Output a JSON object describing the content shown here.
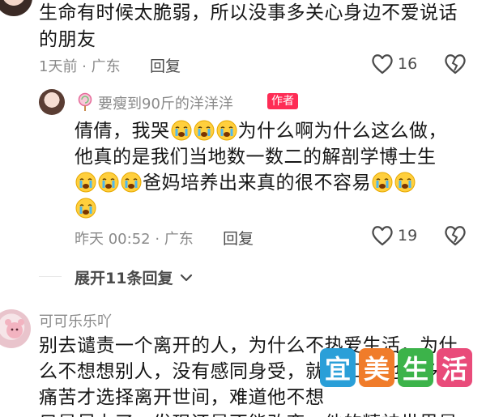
{
  "comment1": {
    "text_line1": "生命有时候太脆弱，所以没事多关心身边不爱说话",
    "text_line2": "的朋友",
    "meta": "1天前 · 广东",
    "reply_label": "回复",
    "likes": "16"
  },
  "reply1": {
    "author": "要瘦到90斤的洋洋洋",
    "author_badge": "作者",
    "line1_a": "倩倩，我哭",
    "line1_b": "为什么啊为什么这么做，",
    "line2": "他真的是我们当地数一数二的解剖学博士生",
    "line3": "爸妈培养出来真的很不容易",
    "meta": "昨天 00:52 · 广东",
    "reply_label": "回复",
    "likes": "19"
  },
  "expand_replies": "展开11条回复",
  "comment2": {
    "author": "可可乐乐吖",
    "line1": "别去谴责一个离开的人，为什么不热爱生活，为什",
    "line2": "么不想想别人，没有感同身受，就不知道他是多么",
    "line3": "痛苦才选择离开世间，难道他不想",
    "line4": "只是尽力了，发现还是不能改变，他的精神世界是"
  },
  "watermark": [
    "宜",
    "美",
    "生",
    "活"
  ],
  "colors": {
    "badge": "#fe2c55",
    "meta": "#8a8a8a",
    "wm1": "#2a9fd8",
    "wm2": "#f07c2a",
    "wm3": "#3cb34a",
    "wm4": "#e94b7a"
  }
}
